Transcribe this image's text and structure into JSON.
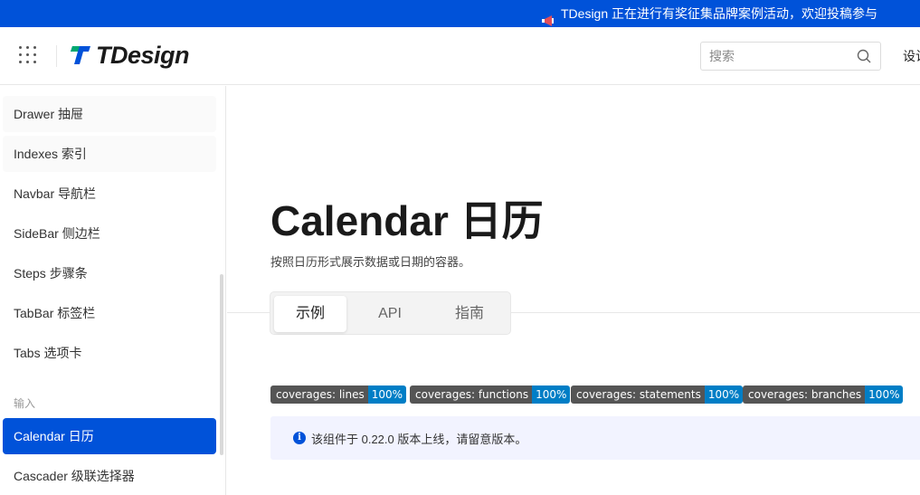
{
  "banner": {
    "text": "TDesign 正在进行有奖征集品牌案例活动，欢迎投稿参与",
    "icon": "megaphone-icon"
  },
  "header": {
    "logo_text": "TDesign",
    "search_placeholder": "搜索",
    "nav_link": "设计"
  },
  "sidebar": {
    "items_top": [
      {
        "label": "Drawer 抽屉"
      },
      {
        "label": "Indexes 索引"
      },
      {
        "label": "Navbar 导航栏"
      },
      {
        "label": "SideBar 侧边栏"
      },
      {
        "label": "Steps 步骤条"
      },
      {
        "label": "TabBar 标签栏"
      },
      {
        "label": "Tabs 选项卡"
      }
    ],
    "group_label": "输入",
    "items_input": [
      {
        "label": "Calendar 日历"
      },
      {
        "label": "Cascader 级联选择器"
      }
    ]
  },
  "main": {
    "title": "Calendar 日历",
    "description": "按照日历形式展示数据或日期的容器。",
    "tabs": [
      {
        "label": "示例"
      },
      {
        "label": "API"
      },
      {
        "label": "指南"
      }
    ],
    "badges": [
      {
        "label": "coverages: lines",
        "value": "100%"
      },
      {
        "label": "coverages: functions",
        "value": "100%"
      },
      {
        "label": "coverages: statements",
        "value": "100%"
      },
      {
        "label": "coverages: branches",
        "value": "100%"
      }
    ],
    "notice": "该组件于 0.22.0 版本上线，请留意版本。"
  },
  "colors": {
    "brand": "#0052d9",
    "badge_label_bg": "#555555",
    "badge_value_bg": "#007ec6",
    "notice_bg": "#f2f3ff"
  }
}
